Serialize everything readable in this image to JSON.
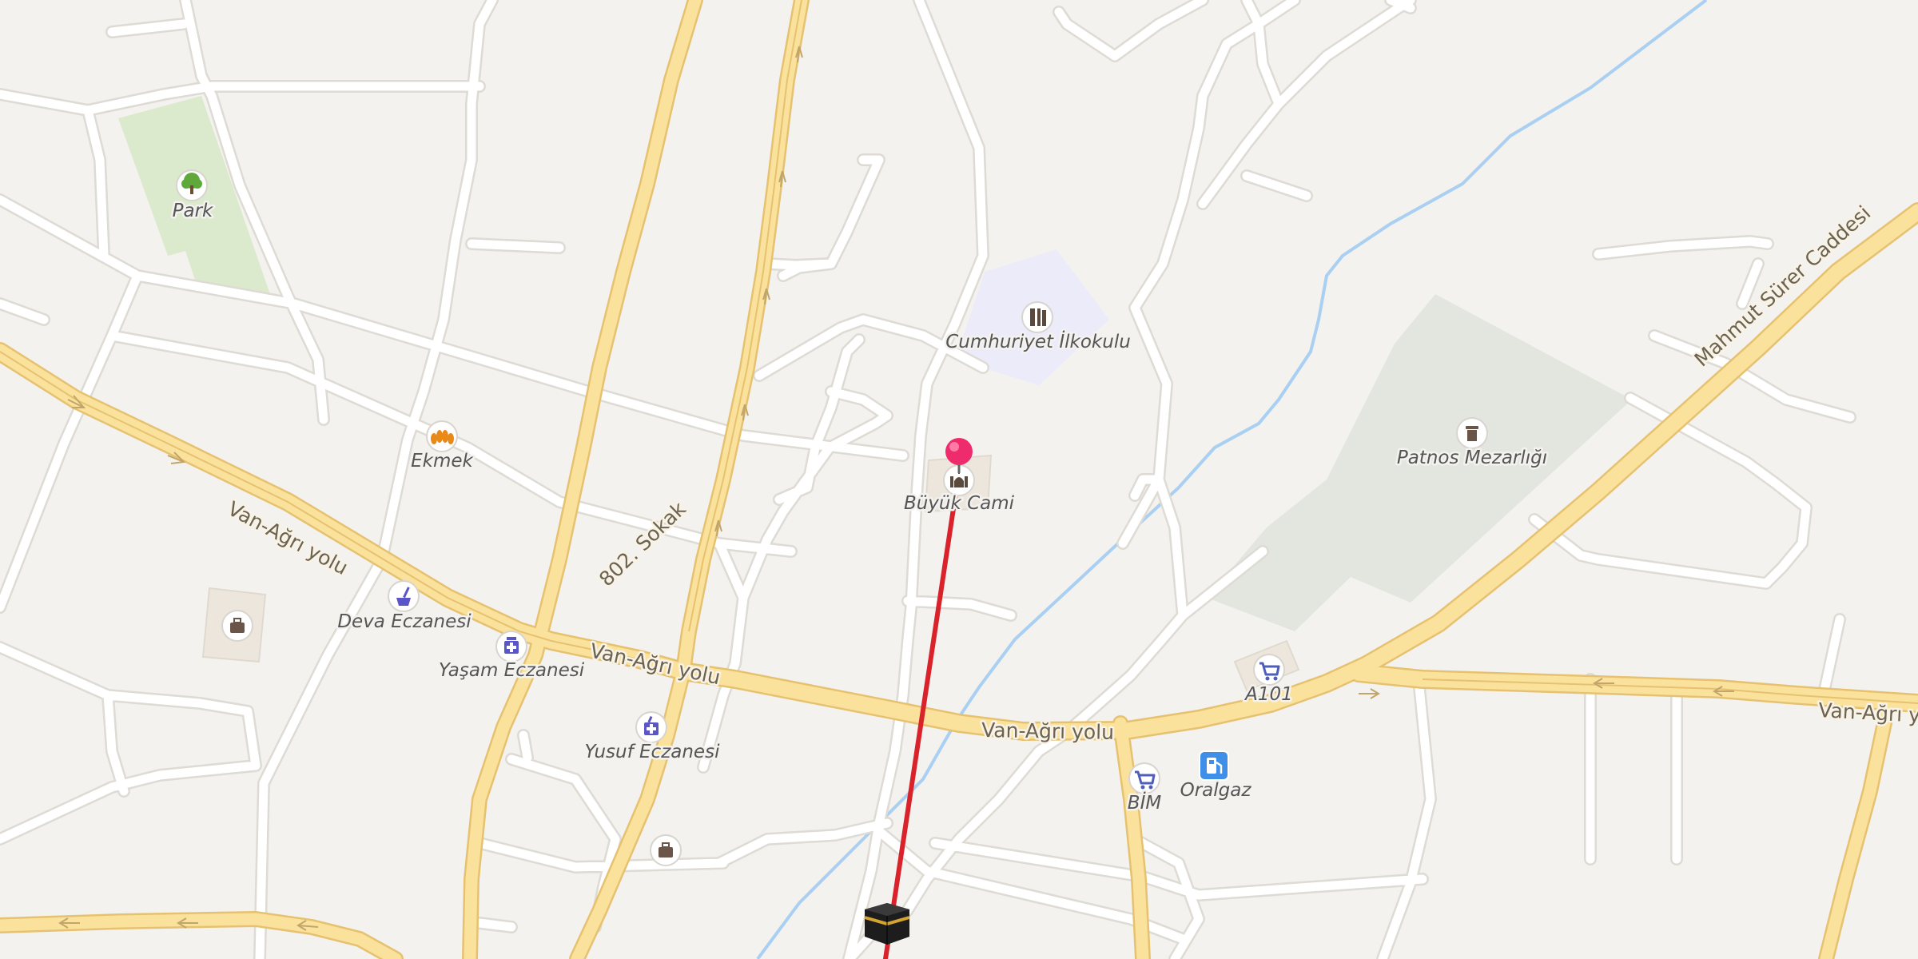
{
  "map": {
    "places": {
      "park": "Park",
      "bakery": "Ekmek",
      "school": "Cumhuriyet İlkokulu",
      "mosque": "Büyük Cami",
      "cemetery": "Patnos Mezarlığı",
      "pharmacy_deva": "Deva Eczanesi",
      "pharmacy_yasam": "Yaşam Eczanesi",
      "pharmacy_yusuf": "Yusuf Eczanesi",
      "shop_a101": "A101",
      "shop_bim": "BİM",
      "fuel": "Oralgaz"
    },
    "roads": {
      "van_agri_1": "Van-Ağrı yolu",
      "van_agri_2": "Van-Ağrı yolu",
      "van_agri_3": "Van-Ağrı yolu",
      "van_agri_4": "Van-Ağrı yolu",
      "street_802": "802. Sokak",
      "mahmut": "Mahmut Sürer Caddesi"
    },
    "icons": {
      "park": "tree-icon",
      "bakery": "bread-icon",
      "school": "school-icon",
      "mosque": "mosque-icon",
      "cemetery": "grave-icon",
      "pharmacy": "pharmacy-icon",
      "shop": "shopping-cart-icon",
      "fuel": "fuel-pump-icon",
      "kaaba": "kaaba-icon",
      "marker": "location-pin-icon"
    },
    "colors": {
      "background": "#f4f2ef",
      "major_road": "#fbe29c",
      "minor_road": "#ffffff",
      "park": "#dbe9cd",
      "cemetery": "#e2e6df",
      "school": "#ecebf9",
      "river": "#a9cff2",
      "qibla_line": "#d9222a",
      "marker": "#ee2b6c"
    }
  }
}
